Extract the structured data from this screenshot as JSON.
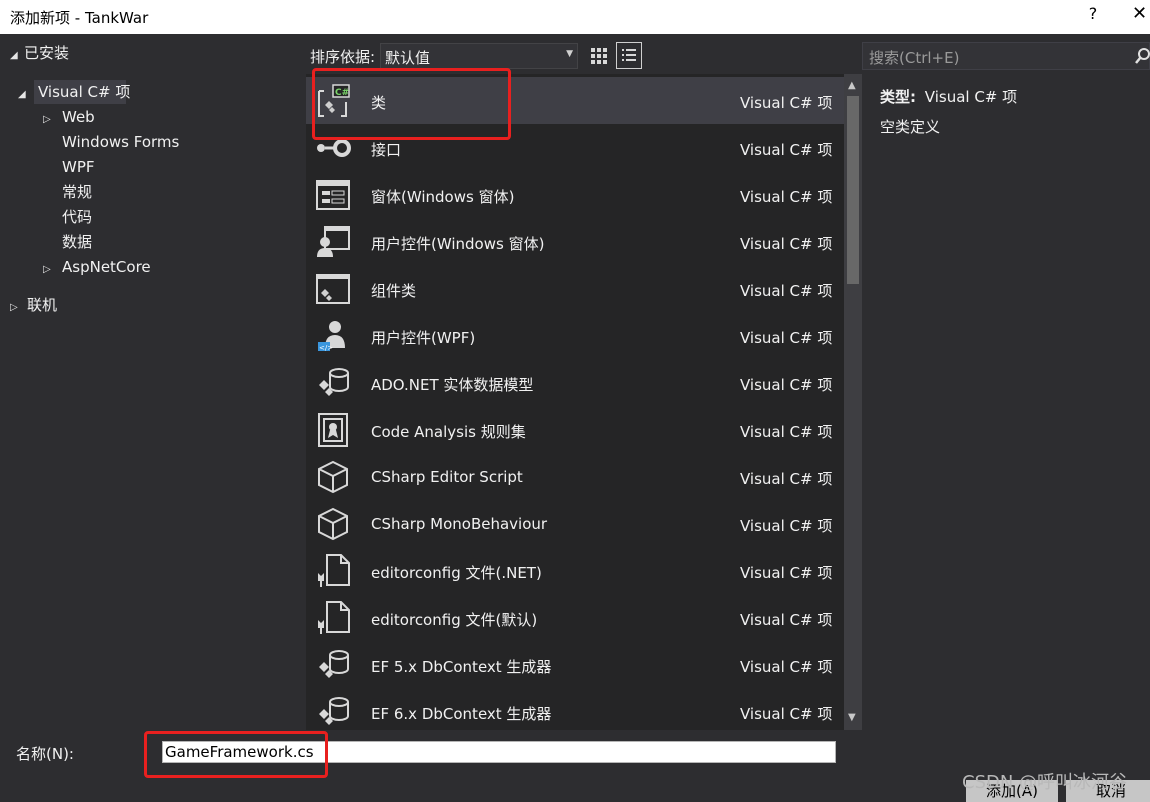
{
  "window": {
    "title": "添加新项 - TankWar",
    "help": "?",
    "close": "✕"
  },
  "tree": {
    "installed": "已安装",
    "csharp_items": "Visual C# 项",
    "children": [
      "Web",
      "Windows Forms",
      "WPF",
      "常规",
      "代码",
      "数据",
      "AspNetCore"
    ],
    "online": "联机"
  },
  "toolbar": {
    "sort_label": "排序依据:",
    "sort_value": "默认值",
    "search_placeholder": "搜索(Ctrl+E)"
  },
  "items": [
    {
      "name": "类",
      "type": "Visual C# 项",
      "icon": "class-icon"
    },
    {
      "name": "接口",
      "type": "Visual C# 项",
      "icon": "interface-icon"
    },
    {
      "name": "窗体(Windows 窗体)",
      "type": "Visual C# 项",
      "icon": "form-icon"
    },
    {
      "name": "用户控件(Windows 窗体)",
      "type": "Visual C# 项",
      "icon": "user-control-icon"
    },
    {
      "name": "组件类",
      "type": "Visual C# 项",
      "icon": "component-icon"
    },
    {
      "name": "用户控件(WPF)",
      "type": "Visual C# 项",
      "icon": "wpf-user-control-icon"
    },
    {
      "name": "ADO.NET 实体数据模型",
      "type": "Visual C# 项",
      "icon": "data-model-icon"
    },
    {
      "name": "Code Analysis 规则集",
      "type": "Visual C# 项",
      "icon": "ruleset-icon"
    },
    {
      "name": "CSharp Editor Script",
      "type": "Visual C# 项",
      "icon": "cube-icon"
    },
    {
      "name": "CSharp MonoBehaviour",
      "type": "Visual C# 项",
      "icon": "cube-icon"
    },
    {
      "name": "editorconfig 文件(.NET)",
      "type": "Visual C# 项",
      "icon": "config-file-icon"
    },
    {
      "name": "editorconfig 文件(默认)",
      "type": "Visual C# 项",
      "icon": "config-file-icon"
    },
    {
      "name": "EF 5.x DbContext 生成器",
      "type": "Visual C# 项",
      "icon": "data-model-icon"
    },
    {
      "name": "EF 6.x DbContext 生成器",
      "type": "Visual C# 项",
      "icon": "data-model-icon"
    }
  ],
  "detail": {
    "type_label": "类型:",
    "type_value": "Visual C# 项",
    "description": "空类定义"
  },
  "bottom": {
    "name_label": "名称(N):",
    "name_value": "GameFramework.cs",
    "add_button": "添加(A)",
    "cancel_button": "取消"
  },
  "watermark": "CSDN @呼叫冰河谷",
  "colors": {
    "background": "#2d2d30",
    "list_background": "#252526",
    "selection": "#3f3f46",
    "annotation": "#e8201f"
  }
}
